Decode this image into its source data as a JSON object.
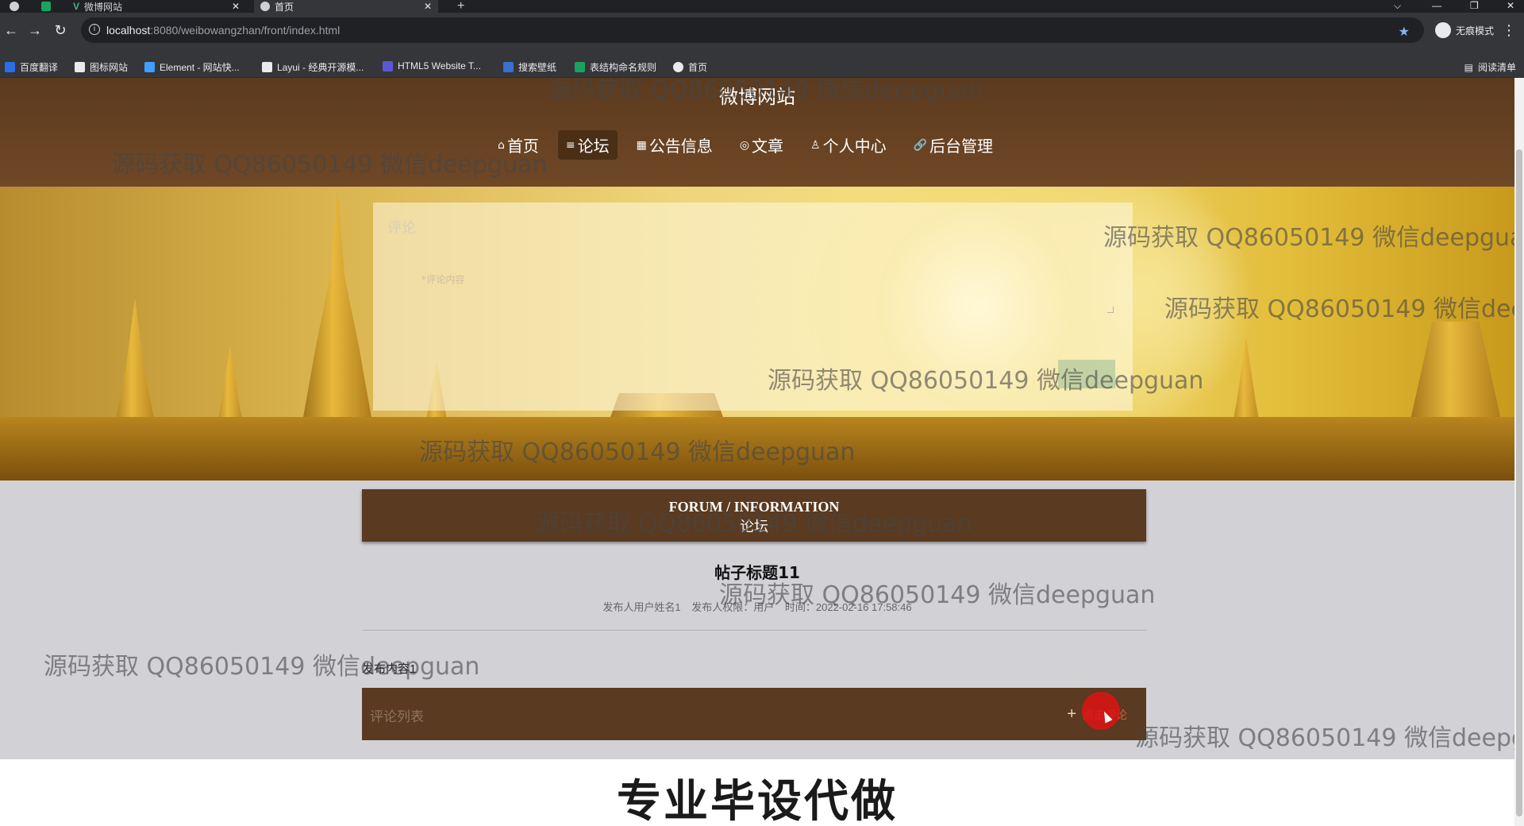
{
  "browser": {
    "tabs": [
      {
        "label": "",
        "icon": "github-icon"
      },
      {
        "label": "",
        "icon": "sheet-icon"
      },
      {
        "label": "微博网站",
        "icon": "vue-icon"
      },
      {
        "label": "首页",
        "icon": "globe-icon"
      }
    ],
    "new_tab": "+",
    "url_host": "localhost",
    "url_path": ":8080/weibowangzhan/front/index.html",
    "incognito_label": "无痕模式",
    "bookmarks": [
      {
        "label": "百度翻译",
        "color": "#2a6ee8"
      },
      {
        "label": "图标网站",
        "color": "#e8eaed"
      },
      {
        "label": "Element - 网站快...",
        "color": "#409eff"
      },
      {
        "label": "Layui - 经典开源模...",
        "color": "#e8eaed"
      },
      {
        "label": "HTML5 Website T...",
        "color": "#5a58d6"
      },
      {
        "label": "搜索壁纸",
        "color": "#3b6fd0"
      },
      {
        "label": "表结构命名规则",
        "color": "#1aa260"
      },
      {
        "label": "首页",
        "color": "#e8eaed"
      }
    ],
    "reading_list": "阅读清单"
  },
  "site": {
    "title": "微博网站",
    "nav": [
      {
        "label": "首页",
        "glyph": "⌂",
        "active": false
      },
      {
        "label": "论坛",
        "glyph": "≡",
        "active": true
      },
      {
        "label": "公告信息",
        "glyph": "▦",
        "active": false
      },
      {
        "label": "文章",
        "glyph": "◎",
        "active": false
      },
      {
        "label": "个人中心",
        "glyph": "♙",
        "active": false
      },
      {
        "label": "后台管理",
        "glyph": "🔗",
        "active": false
      }
    ]
  },
  "comment_form": {
    "heading": "评论",
    "placeholder": "*评论内容"
  },
  "forum": {
    "header_en": "FORUM / INFORMATION",
    "header_cn": "论坛",
    "post_title": "帖子标题11",
    "publisher": "发布人用户姓名1",
    "permission": "发布人权限：用户",
    "time": "时间：2022-02-16 17:58:46",
    "content": "发布内容1",
    "comments_label": "评论列表",
    "add_comment": "点击评论"
  },
  "footer": {
    "text": "专业毕设代做"
  },
  "watermark": "源码获取 QQ86050149 微信deepguan"
}
